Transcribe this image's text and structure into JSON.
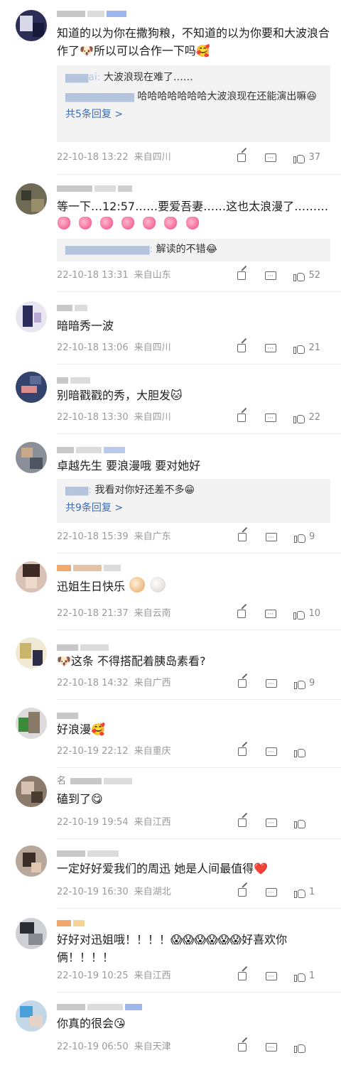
{
  "comments": [
    {
      "text": "知道的以为你在撒狗粮，不知道的以为你要和大波浪合作了🐶所以可以合作一下吗🥰",
      "replies": [
        {
          "name": "",
          "text": "大波浪现在难了……"
        },
        {
          "name": "",
          "text": "哈哈哈哈哈哈哈大波浪现在还能演出嘛😆"
        }
      ],
      "more_replies": "共5条回复 >",
      "date": "22-10-18 13:22",
      "location": "来自四川",
      "likes": "37"
    },
    {
      "text": "等一下…12:57……要爱吾妻……这也太浪漫了………",
      "emoji_row": [
        "💗",
        "💗",
        "💗",
        "💗",
        "💗",
        "💗",
        "💗"
      ],
      "replies": [
        {
          "name": "",
          "text": "解读的不错😂"
        }
      ],
      "date": "22-10-18 13:31",
      "location": "来自山东",
      "likes": "52"
    },
    {
      "text": "暗暗秀一波",
      "date": "22-10-18 13:06",
      "location": "来自四川",
      "likes": "21"
    },
    {
      "text": "别暗戳戳的秀，大胆发🐱",
      "date": "22-10-18 13:30",
      "location": "来自四川",
      "likes": "22"
    },
    {
      "text": "卓越先生 要浪漫哦 要对她好",
      "replies": [
        {
          "name": "",
          "text": "我看对你好还差不多😁"
        }
      ],
      "more_replies": "共9条回复 >",
      "date": "22-10-18 15:39",
      "location": "来自广东",
      "likes": "9"
    },
    {
      "text": "迅姐生日快乐",
      "date": "22-10-18 21:37",
      "location": "来自云南",
      "likes": "10"
    },
    {
      "text": "🐶这条  不得搭配着胰岛素看?",
      "date": "22-10-18 14:32",
      "location": "来自广西",
      "likes": "9"
    },
    {
      "text": "好浪漫🥰",
      "date": "22-10-19 22:12",
      "location": "来自重庆",
      "likes": ""
    },
    {
      "username_prefix": "名",
      "text": "磕到了😋",
      "date": "22-10-19 19:54",
      "location": "来自江西",
      "likes": ""
    },
    {
      "text": "一定好好爱我们的周迅 她是人间最值得❤️",
      "date": "22-10-19 16:30",
      "location": "来自湖北",
      "likes": "1"
    },
    {
      "text": "好好对迅姐哦！！！！😱😱😱😱😱😱好喜欢你俩！！！！",
      "date": "22-10-19 10:25",
      "location": "来自江西",
      "likes": "1"
    },
    {
      "text": "你真的很会😘",
      "date": "22-10-19 06:50",
      "location": "来自天津",
      "likes": ""
    }
  ]
}
